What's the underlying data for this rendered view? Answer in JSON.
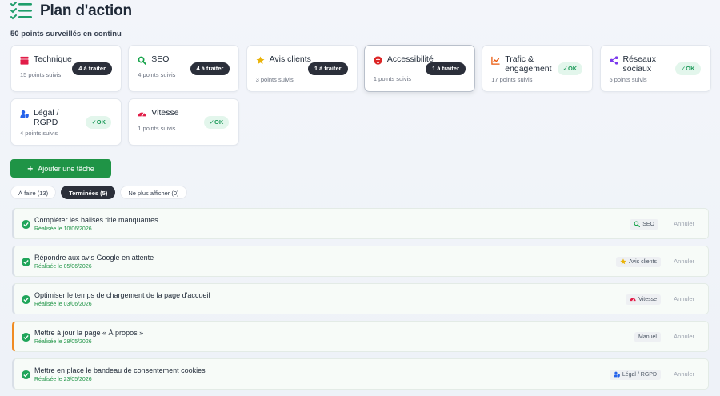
{
  "header": {
    "title": "Plan d'action",
    "subtitle": "50 points surveillés en continu"
  },
  "cards": [
    {
      "title": "Technique",
      "meta": "15 points suivis",
      "status": "4 à traiter",
      "status_type": "todo",
      "icon": "server-icon",
      "icon_color": "#e11d48"
    },
    {
      "title": "SEO",
      "meta": "4 points suivis",
      "status": "4 à traiter",
      "status_type": "todo",
      "icon": "search-icon",
      "icon_color": "#16a34a"
    },
    {
      "title": "Avis clients",
      "meta": "3 points suivis",
      "status": "1 à traiter",
      "status_type": "todo",
      "icon": "star-icon",
      "icon_color": "#eab308"
    },
    {
      "title": "Accessibilité",
      "meta": "1 points suivis",
      "status": "1 à traiter",
      "status_type": "todo",
      "icon": "accessibility-icon",
      "icon_color": "#dc2626",
      "selected": true
    },
    {
      "title": "Trafic & engagement",
      "meta": "17 points suivis",
      "status": "OK",
      "status_type": "ok",
      "icon": "chart-line-icon",
      "icon_color": "#ea580c"
    },
    {
      "title": "Réseaux sociaux",
      "meta": "5 points suivis",
      "status": "OK",
      "status_type": "ok",
      "icon": "share-icon",
      "icon_color": "#7c3aed"
    },
    {
      "title": "Légal / RGPD",
      "meta": "4 points suivis",
      "status": "OK",
      "status_type": "ok",
      "icon": "user-shield-icon",
      "icon_color": "#2563eb"
    },
    {
      "title": "Vitesse",
      "meta": "1 points suivis",
      "status": "OK",
      "status_type": "ok",
      "icon": "gauge-icon",
      "icon_color": "#e11d48"
    }
  ],
  "add_button": {
    "label": "Ajouter une tâche"
  },
  "tabs": [
    {
      "label": "À faire (13)",
      "active": false
    },
    {
      "label": "Terminées (5)",
      "active": true
    },
    {
      "label": "Ne plus afficher (0)",
      "active": false
    }
  ],
  "tasks": [
    {
      "title": "Compléter les balises title manquantes",
      "date": "Réalisée le 10/06/2026",
      "tag": "SEO",
      "tag_icon": "search-icon",
      "cancel": "Annuler"
    },
    {
      "title": "Répondre aux avis Google en attente",
      "date": "Réalisée le 05/06/2026",
      "tag": "Avis clients",
      "tag_icon": "star-icon",
      "cancel": "Annuler"
    },
    {
      "title": "Optimiser le temps de chargement de la page d'accueil",
      "date": "Réalisée le 03/06/2026",
      "tag": "Vitesse",
      "tag_icon": "gauge-icon",
      "cancel": "Annuler"
    },
    {
      "title": "Mettre à jour la page « À propos »",
      "date": "Réalisée le 28/05/2026",
      "tag": "Manuel",
      "tag_icon": "",
      "cancel": "Annuler",
      "manual": true
    },
    {
      "title": "Mettre en place le bandeau de consentement cookies",
      "date": "Réalisée le 23/05/2026",
      "tag": "Légal / RGPD",
      "tag_icon": "user-shield-icon",
      "cancel": "Annuler"
    }
  ],
  "colors": {
    "accent_green": "#1f9446",
    "dark_badge": "#2b2f3a",
    "ok_bg": "#e3f6ec",
    "manual_border": "#f08c23"
  }
}
